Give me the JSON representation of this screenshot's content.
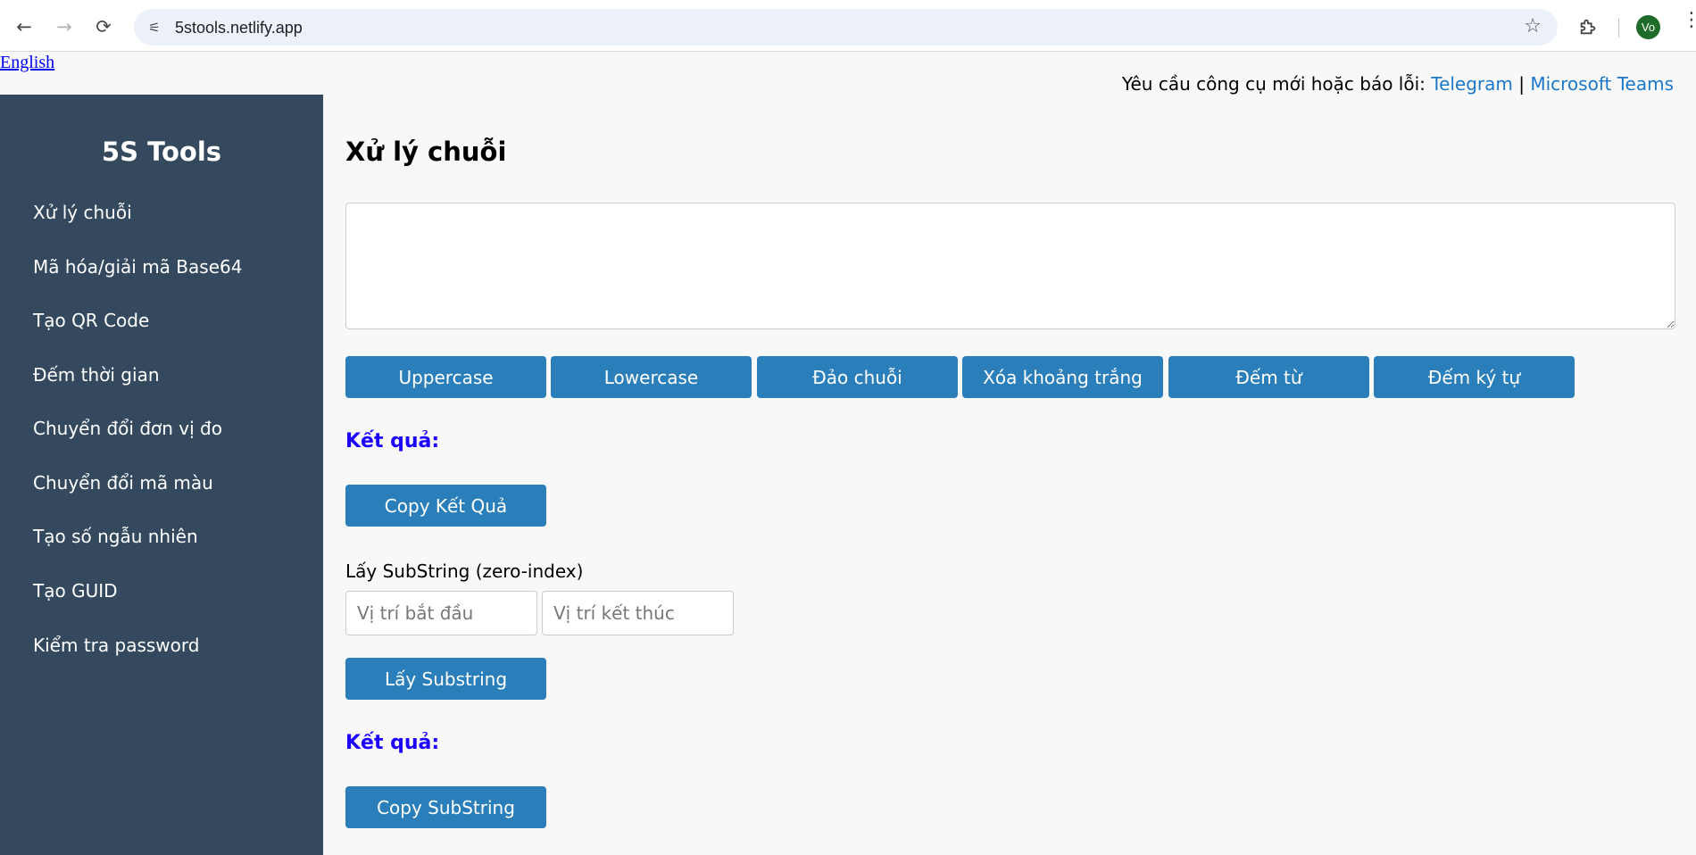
{
  "browser": {
    "url": "5stools.netlify.app",
    "profile_initials": "Vo",
    "back_glyph": "←",
    "forward_glyph": "→",
    "reload_glyph": "⟳",
    "star_glyph": "☆",
    "menu_glyph": "⋮",
    "tune_glyph": "⚟"
  },
  "page": {
    "language_link": "English",
    "report_prefix": "Yêu cầu công cụ mới hoặc báo lỗi: ",
    "report_telegram": "Telegram",
    "report_separator": " | ",
    "report_teams": "Microsoft Teams",
    "link_color": "#1b78c8"
  },
  "sidebar": {
    "brand": "5S Tools",
    "background": "#34495e",
    "items": [
      {
        "label": "Xử lý chuỗi"
      },
      {
        "label": "Mã hóa/giải mã Base64"
      },
      {
        "label": "Tạo QR Code"
      },
      {
        "label": "Đếm thời gian"
      },
      {
        "label": "Chuyển đổi đơn vị đo"
      },
      {
        "label": "Chuyển đổi mã màu"
      },
      {
        "label": "Tạo số ngẫu nhiên"
      },
      {
        "label": "Tạo GUID"
      },
      {
        "label": "Kiểm tra password"
      }
    ]
  },
  "main": {
    "title": "Xử lý chuỗi",
    "input_value": "",
    "button_color": "#2a7fba",
    "result_color": "#1c00ff",
    "actions": [
      {
        "label": "Uppercase"
      },
      {
        "label": "Lowercase"
      },
      {
        "label": "Đảo chuỗi"
      },
      {
        "label": "Xóa khoảng trắng"
      },
      {
        "label": "Đếm từ"
      },
      {
        "label": "Đếm ký tự"
      }
    ],
    "result_label": "Kết quả:",
    "copy_result_label": "Copy Kết Quả",
    "substring_label": "Lấy SubString (zero-index)",
    "start_placeholder": "Vị trí bắt đầu",
    "end_placeholder": "Vị trí kết thúc",
    "substring_button": "Lấy Substring",
    "substring_result_label": "Kết quả:",
    "copy_substring_label": "Copy SubString"
  }
}
